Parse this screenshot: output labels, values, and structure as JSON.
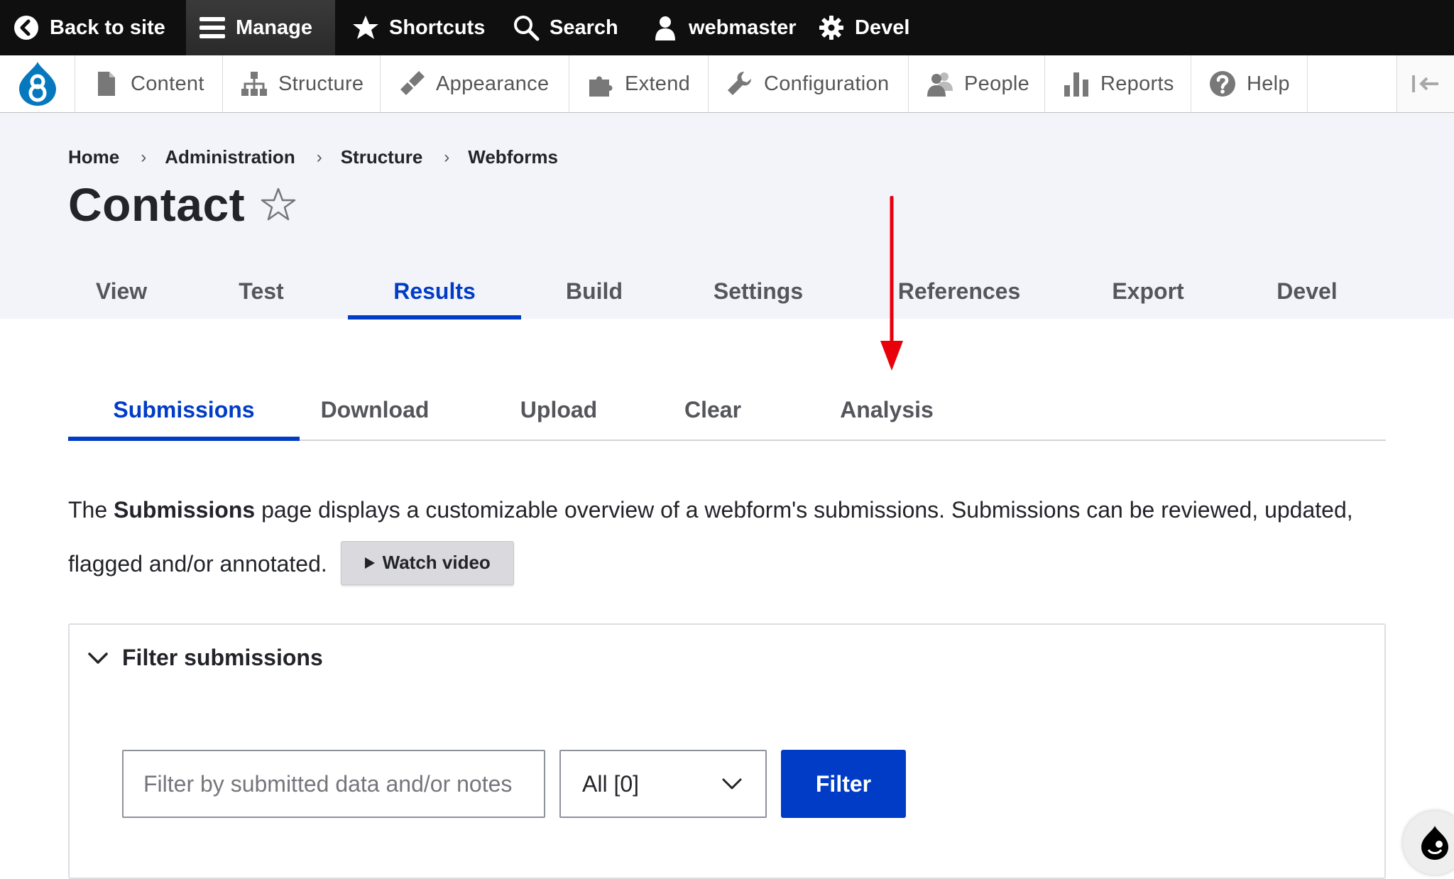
{
  "toolbar": {
    "back_to_site": "Back to site",
    "manage": "Manage",
    "shortcuts": "Shortcuts",
    "search": "Search",
    "user": "webmaster",
    "devel": "Devel"
  },
  "tray": {
    "items": [
      {
        "label": "Content",
        "icon": "content-icon"
      },
      {
        "label": "Structure",
        "icon": "structure-icon"
      },
      {
        "label": "Appearance",
        "icon": "appearance-icon"
      },
      {
        "label": "Extend",
        "icon": "extend-icon"
      },
      {
        "label": "Configuration",
        "icon": "configuration-icon"
      },
      {
        "label": "People",
        "icon": "people-icon"
      },
      {
        "label": "Reports",
        "icon": "reports-icon"
      },
      {
        "label": "Help",
        "icon": "help-icon"
      }
    ]
  },
  "breadcrumb": [
    "Home",
    "Administration",
    "Structure",
    "Webforms"
  ],
  "page": {
    "title": "Contact"
  },
  "primary_tabs": [
    "View",
    "Test",
    "Results",
    "Build",
    "Settings",
    "References",
    "Export",
    "Devel"
  ],
  "primary_active": "Results",
  "secondary_tabs": [
    "Submissions",
    "Download",
    "Upload",
    "Clear",
    "Analysis"
  ],
  "secondary_active": "Submissions",
  "description": {
    "prefix": "The ",
    "bold": "Submissions",
    "suffix": " page displays a customizable overview of a webform's submissions. Submissions can be reviewed, updated, flagged and/or annotated.",
    "watch_video": "Watch video"
  },
  "filter": {
    "legend": "Filter submissions",
    "search_placeholder": "Filter by submitted data and/or notes",
    "search_value": "",
    "state_selected": "All [0]",
    "button": "Filter"
  },
  "colors": {
    "accent": "#003cc5",
    "annotation_arrow": "#e8000b",
    "toolbar_bg": "#0f0f0f",
    "header_bg": "#f3f4f9"
  }
}
